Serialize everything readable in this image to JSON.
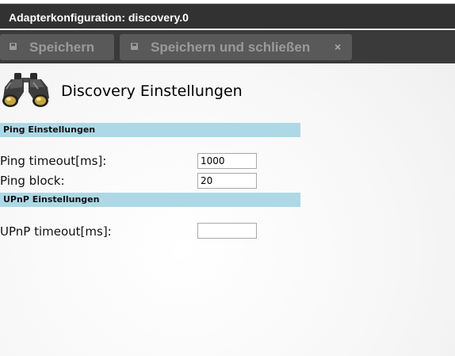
{
  "window": {
    "title": "Adapterkonfiguration: discovery.0"
  },
  "toolbar": {
    "save_label": "Speichern",
    "save_close_label": "Speichern und schließen",
    "close_glyph": "×"
  },
  "page": {
    "title": "Discovery Einstellungen",
    "icon": "binoculars-icon"
  },
  "sections": {
    "ping": {
      "header": "Ping Einstellungen",
      "timeout_label": "Ping timeout[ms]:",
      "timeout_value": "1000",
      "block_label": "Ping block:",
      "block_value": "20"
    },
    "upnp": {
      "header": "UPnP Einstellungen",
      "timeout_label": "UPnP timeout[ms]:",
      "timeout_value": ""
    }
  },
  "colors": {
    "titlebar": "#323232",
    "toolbar": "#3a3a3a",
    "button": "#595959",
    "section_header": "#add8e6"
  }
}
